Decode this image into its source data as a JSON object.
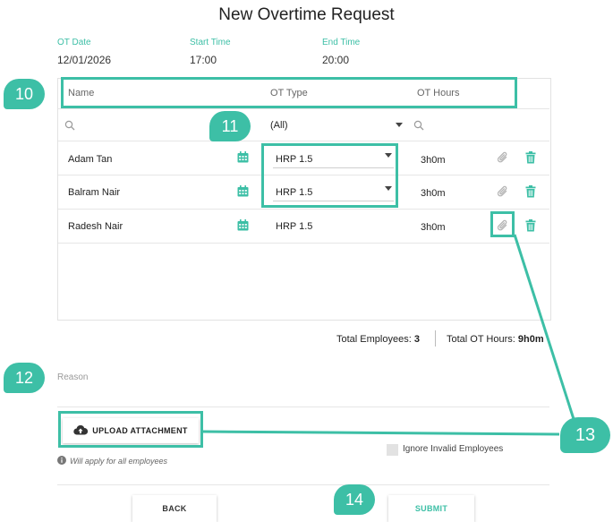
{
  "page": {
    "title": "New Overtime Request"
  },
  "fields": {
    "ot_date": {
      "label": "OT Date",
      "value": "12/01/2026"
    },
    "start_time": {
      "label": "Start Time",
      "value": "17:00"
    },
    "end_time": {
      "label": "End Time",
      "value": "20:00"
    }
  },
  "grid": {
    "columns": {
      "name": "Name",
      "ot_type": "OT Type",
      "ot_hours": "OT Hours"
    },
    "filter": {
      "ot_type": "(All)"
    },
    "rows": [
      {
        "name": "Adam Tan",
        "ot_type": "HRP 1.5",
        "ot_hours": "3h0m"
      },
      {
        "name": "Balram Nair",
        "ot_type": "HRP 1.5",
        "ot_hours": "3h0m"
      },
      {
        "name": "Radesh Nair",
        "ot_type": "HRP 1.5",
        "ot_hours": "3h0m"
      }
    ]
  },
  "summary": {
    "total_employees_label": "Total Employees:",
    "total_employees_value": "3",
    "total_hours_label": "Total OT Hours:",
    "total_hours_value": "9h0m"
  },
  "reason": {
    "placeholder": "Reason"
  },
  "upload": {
    "label": "UPLOAD ATTACHMENT",
    "note": "Will apply for all employees"
  },
  "ignore_invalid": {
    "label": "Ignore Invalid Employees"
  },
  "actions": {
    "back": "BACK",
    "submit": "SUBMIT"
  },
  "callouts": {
    "c10": "10",
    "c11": "11",
    "c12": "12",
    "c13": "13",
    "c14": "14"
  },
  "colors": {
    "accent": "#3dbfa6"
  }
}
